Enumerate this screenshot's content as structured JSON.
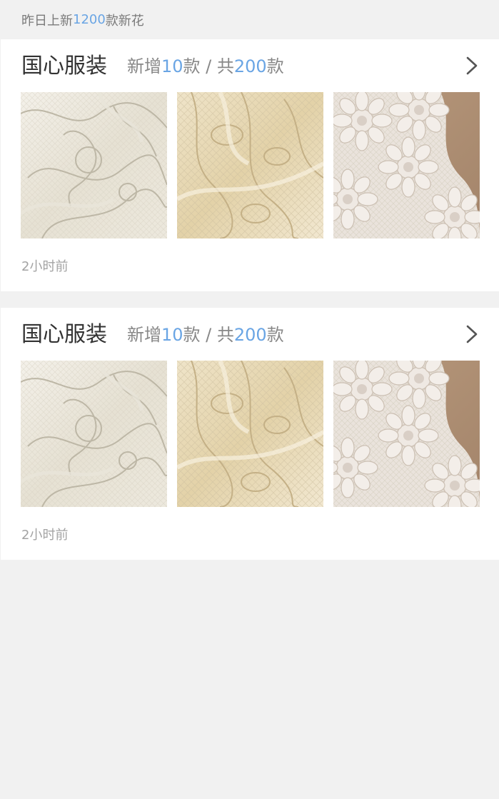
{
  "summary": {
    "prefix": "昨日上新",
    "count": "1200",
    "suffix": "款新花"
  },
  "feed": [
    {
      "shop_name": "国心服装",
      "added_prefix": "新增",
      "added_count": "10",
      "added_unit": "款",
      "separator": " / ",
      "total_prefix": "共",
      "total_count": "200",
      "total_unit": "款",
      "time": "2小时前"
    },
    {
      "shop_name": "国心服装",
      "added_prefix": "新增",
      "added_count": "10",
      "added_unit": "款",
      "separator": " / ",
      "total_prefix": "共",
      "total_count": "200",
      "total_unit": "款",
      "time": "2小时前"
    }
  ],
  "colors": {
    "highlight": "#6aa5e4",
    "background": "#f1f1f1",
    "card": "#ffffff"
  },
  "icons": {
    "more": "chevron-right-icon"
  }
}
